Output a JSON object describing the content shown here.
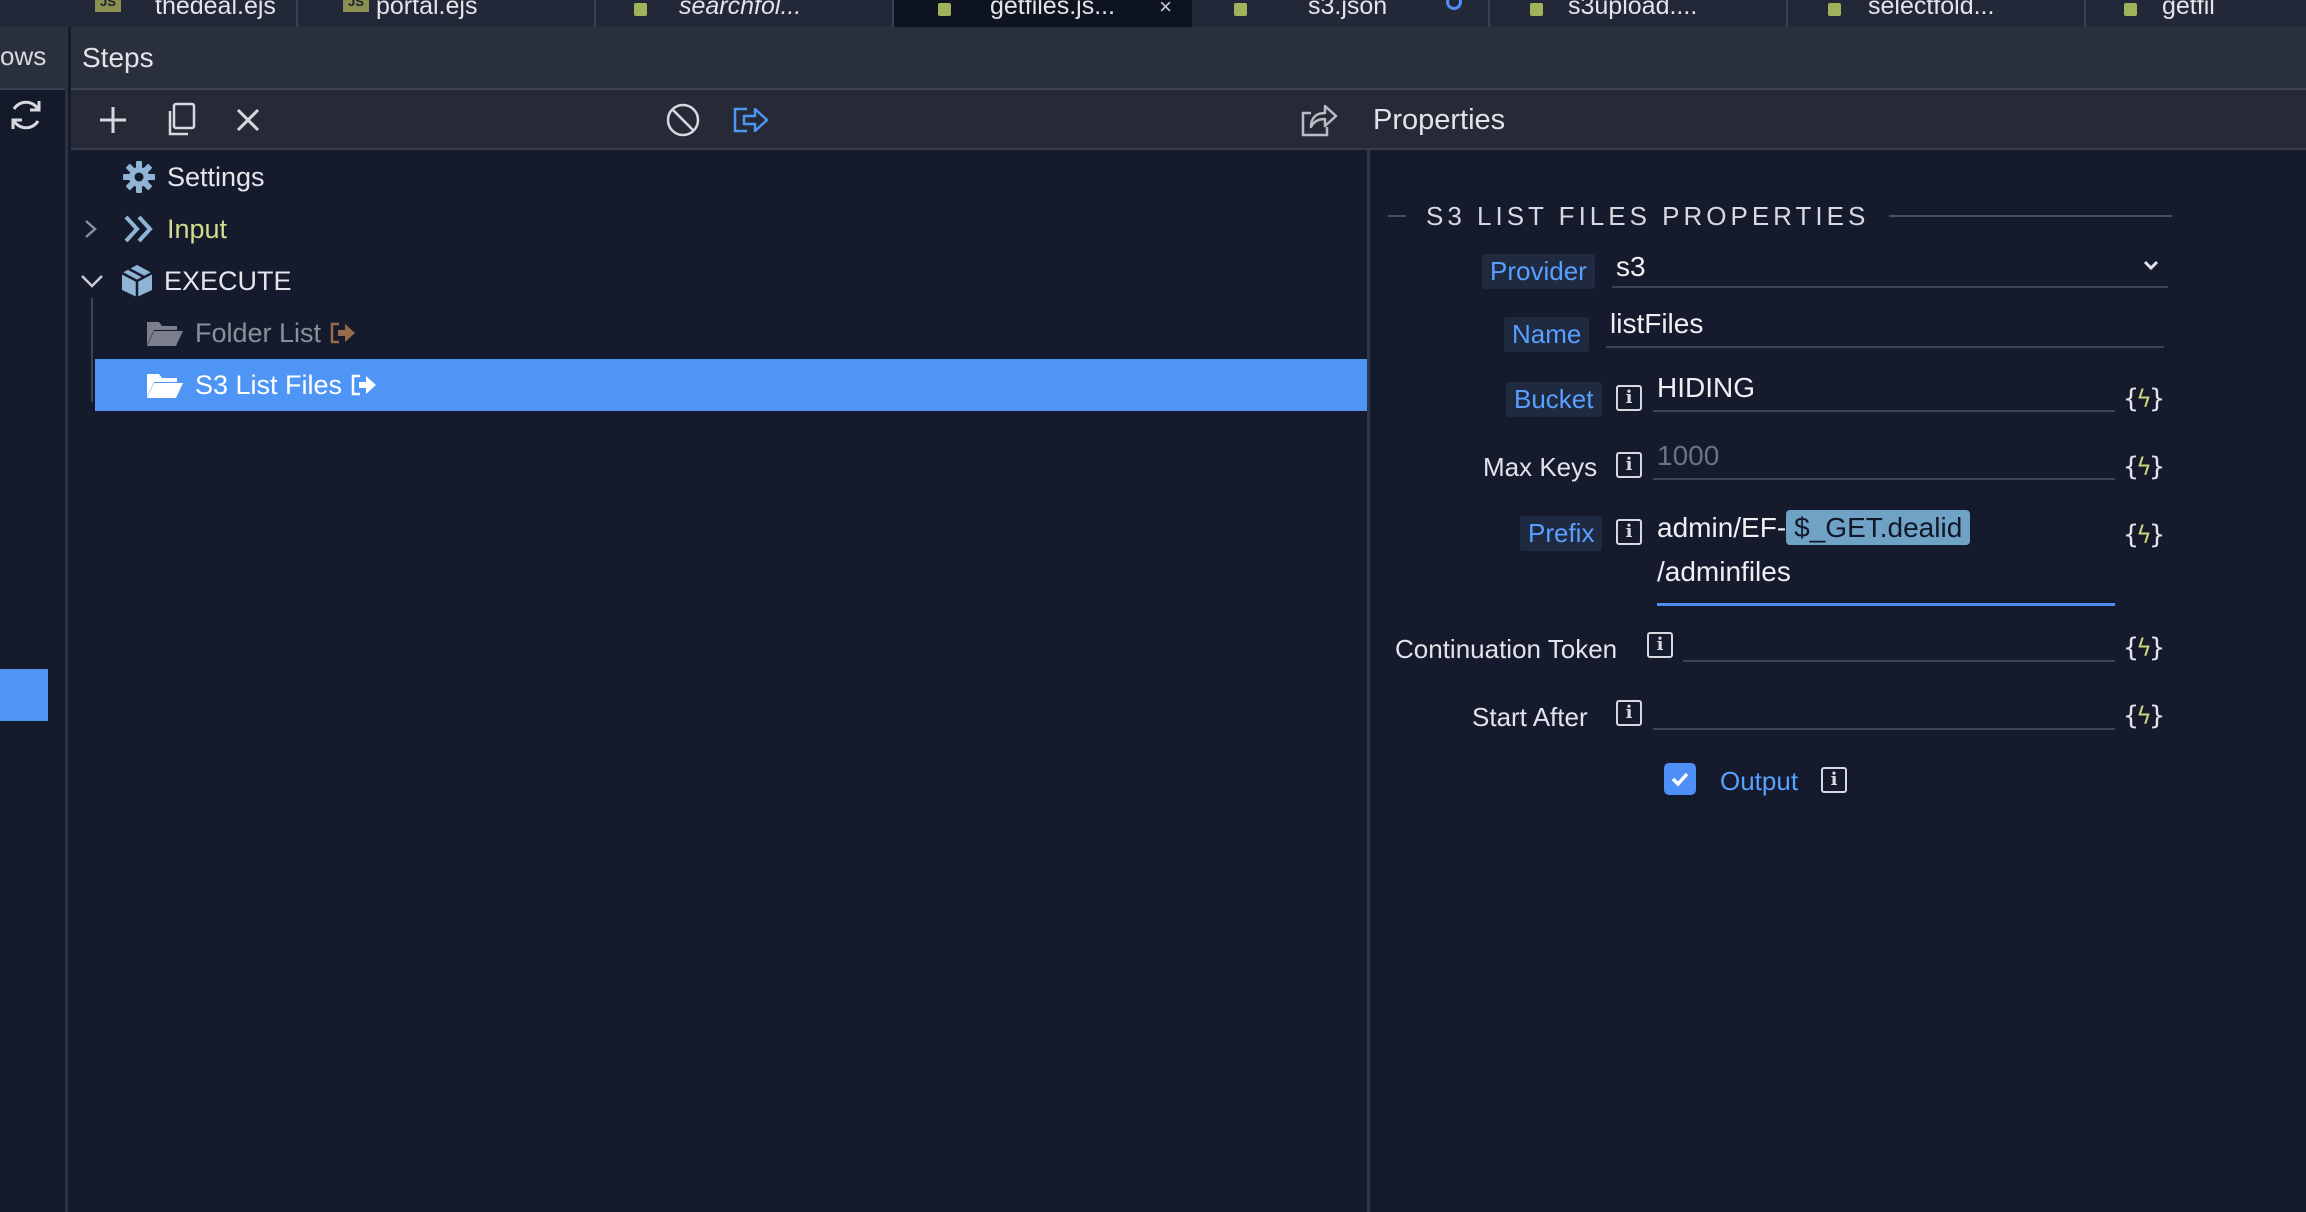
{
  "tabs": [
    {
      "label": "thedeal.ejs",
      "kind": "js",
      "active": false
    },
    {
      "label": "portal.ejs",
      "kind": "js",
      "active": false
    },
    {
      "label": "searchfol...",
      "kind": "dot",
      "active": false,
      "italic": true
    },
    {
      "label": "getfiles.js...",
      "kind": "dot",
      "active": true
    },
    {
      "label": "s3.json",
      "kind": "dot",
      "active": false,
      "modified": true
    },
    {
      "label": "s3upload....",
      "kind": "dot",
      "active": false
    },
    {
      "label": "selectfold...",
      "kind": "dot",
      "active": false
    },
    {
      "label": "getfil",
      "kind": "dot",
      "active": false
    }
  ],
  "tab_js_badge": "JS",
  "tab_close_glyph": "×",
  "left_strip": {
    "title": "ows"
  },
  "steps": {
    "title": "Steps"
  },
  "toolbar": {
    "properties_title": "Properties"
  },
  "tree": {
    "settings": "Settings",
    "input": "Input",
    "execute": "EXECUTE",
    "folder_list": "Folder List",
    "s3_list_files": "S3 List Files"
  },
  "properties": {
    "section_title": "S3 LIST FILES PROPERTIES",
    "provider": {
      "label": "Provider",
      "value": "s3"
    },
    "name": {
      "label": "Name",
      "value": "listFiles"
    },
    "bucket": {
      "label": "Bucket",
      "value": "HIDING"
    },
    "max_keys": {
      "label": "Max Keys",
      "placeholder": "1000"
    },
    "prefix": {
      "label": "Prefix",
      "text_before": "admin/EF-",
      "token": "$_GET.dealid",
      "text_after": "/adminfiles"
    },
    "continuation_token": {
      "label": "Continuation Token",
      "value": ""
    },
    "start_after": {
      "label": "Start After",
      "value": ""
    },
    "output": {
      "label": "Output",
      "checked": true
    }
  },
  "glyphs": {
    "info": "i",
    "dyn_open": "{",
    "dyn_bolt": "ϟ",
    "dyn_close": "}"
  },
  "colors": {
    "accent": "#4e95f5",
    "link_blue": "#57a0ff",
    "input_green": "#cfdd8e"
  }
}
